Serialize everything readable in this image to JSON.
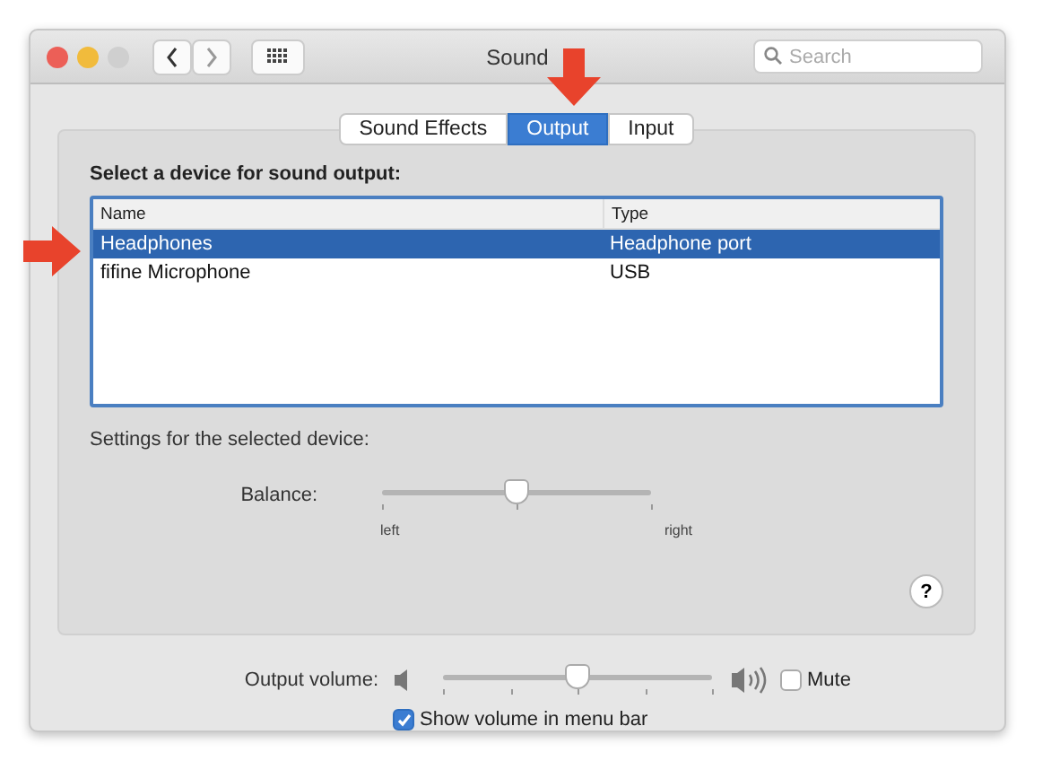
{
  "window": {
    "title": "Sound"
  },
  "search": {
    "placeholder": "Search"
  },
  "tabs": [
    {
      "label": "Sound Effects",
      "selected": false
    },
    {
      "label": "Output",
      "selected": true
    },
    {
      "label": "Input",
      "selected": false
    }
  ],
  "device_list": {
    "heading": "Select a device for sound output:",
    "columns": [
      "Name",
      "Type"
    ],
    "rows": [
      {
        "name": "Headphones",
        "type": "Headphone port",
        "selected": true
      },
      {
        "name": "fifine Microphone",
        "type": "USB",
        "selected": false
      }
    ]
  },
  "settings": {
    "heading": "Settings for the selected device:",
    "balance": {
      "label": "Balance:",
      "level": 0.5,
      "min_label": "left",
      "max_label": "right"
    },
    "help": "?"
  },
  "output_volume": {
    "label": "Output volume:",
    "level": 0.5,
    "mute": {
      "label": "Mute",
      "checked": false
    }
  },
  "show_in_menu_bar": {
    "label": "Show volume in menu bar",
    "checked": true
  }
}
